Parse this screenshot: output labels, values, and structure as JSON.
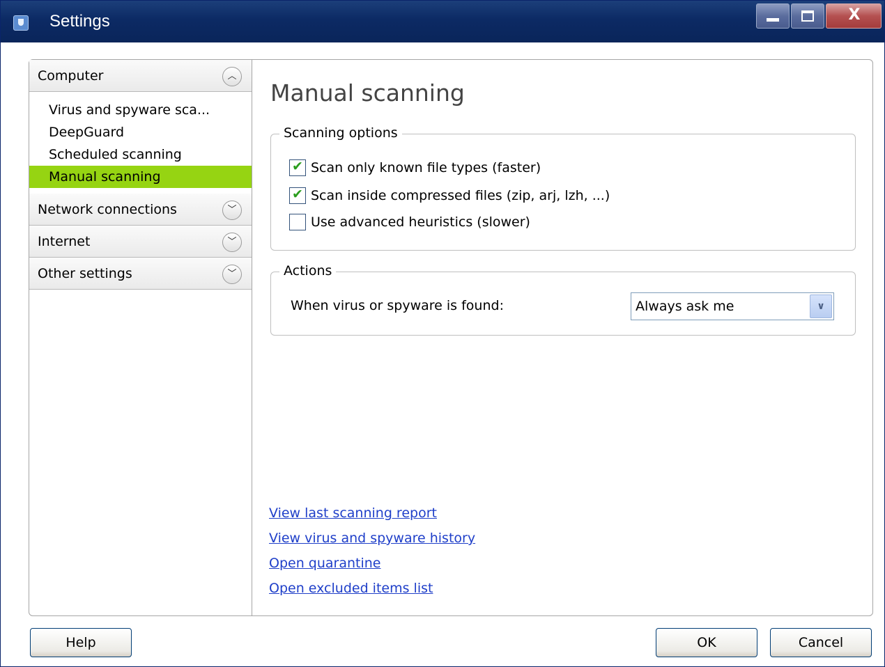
{
  "window": {
    "title": "Settings"
  },
  "title_controls": {
    "close_label": "X"
  },
  "sidebar": {
    "categories": [
      {
        "label": "Computer",
        "expanded": true
      },
      {
        "label": "Network connections",
        "expanded": false
      },
      {
        "label": "Internet",
        "expanded": false
      },
      {
        "label": "Other settings",
        "expanded": false
      }
    ],
    "computer_items": [
      {
        "label": "Virus and spyware sca..."
      },
      {
        "label": "DeepGuard"
      },
      {
        "label": "Scheduled scanning"
      },
      {
        "label": "Manual scanning",
        "selected": true
      }
    ]
  },
  "content": {
    "title": "Manual scanning",
    "scanning_options": {
      "legend": "Scanning options",
      "items": [
        {
          "label": "Scan only known file types (faster)",
          "checked": true
        },
        {
          "label": "Scan inside compressed files (zip, arj, lzh, ...)",
          "checked": true
        },
        {
          "label": "Use advanced heuristics (slower)",
          "checked": false
        }
      ]
    },
    "actions": {
      "legend": "Actions",
      "label": "When virus or spyware is found:",
      "selected": "Always ask me"
    },
    "links": [
      "View last scanning report",
      "View virus and spyware history",
      "Open quarantine",
      "Open excluded items list"
    ]
  },
  "footer": {
    "help": "Help",
    "ok": "OK",
    "cancel": "Cancel"
  },
  "colors": {
    "selected_item": "#96d412",
    "link": "#1f3fc9",
    "titlebar": "#0c2a64"
  }
}
